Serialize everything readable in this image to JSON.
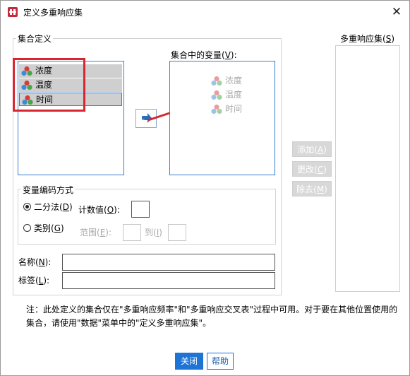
{
  "window": {
    "title": "定义多重响应集",
    "close_glyph": "✕"
  },
  "set_definition": {
    "group_title": "集合定义",
    "source_items": [
      {
        "label": "浓度"
      },
      {
        "label": "温度"
      },
      {
        "label": "时间"
      }
    ],
    "vars_label_pre": "集合中的变量(",
    "vars_label_key": "V",
    "vars_label_post": "):",
    "vars_items": [
      {
        "label": "浓度"
      },
      {
        "label": "温度"
      },
      {
        "label": "时间"
      }
    ]
  },
  "encoding": {
    "group_title": "变量编码方式",
    "dichotomy_pre": "二分法(",
    "dichotomy_key": "D",
    "dichotomy_post": ")",
    "count_pre": "计数值(",
    "count_key": "O",
    "count_post": "):",
    "category_pre": "类别(",
    "category_key": "G",
    "category_post": ")",
    "range_pre": "范围(",
    "range_key": "E",
    "range_post": "):",
    "to_pre": "到(",
    "to_key": "I",
    "to_post": ")"
  },
  "name_field": {
    "pre": "名称(",
    "key": "N",
    "post": "):",
    "value": ""
  },
  "label_field": {
    "pre": "标签(",
    "key": "L",
    "post": "):",
    "value": ""
  },
  "sets": {
    "pre": "多重响应集(",
    "key": "S",
    "post": ")"
  },
  "actions": {
    "add": {
      "pre": "添加(",
      "key": "A",
      "post": ")"
    },
    "change": {
      "pre": "更改(",
      "key": "C",
      "post": ")"
    },
    "remove": {
      "pre": "除去(",
      "key": "M",
      "post": ")"
    }
  },
  "note": "注：此处定义的集合仅在\"多重响应频率\"和\"多重响应交叉表\"过程中可用。对于要在其他位置使用的集合，请使用\"数据\"菜单中的\"定义多重响应集\"。",
  "footer": {
    "close_label": "关闭",
    "help_label": "帮助"
  }
}
